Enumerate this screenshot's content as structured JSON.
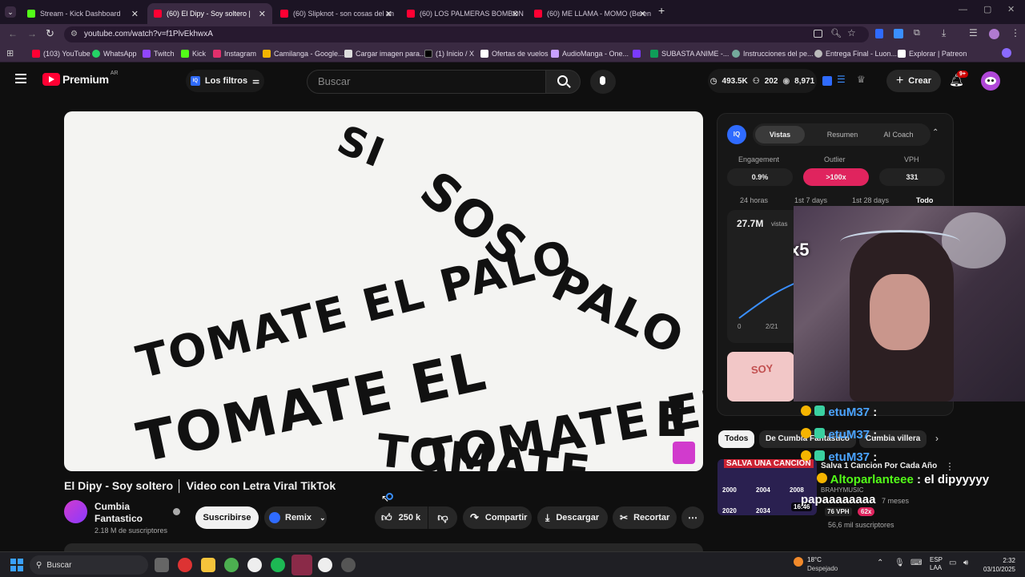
{
  "browser": {
    "tabs": [
      {
        "title": "Stream - Kick Dashboard",
        "color": "#53fc18"
      },
      {
        "title": "(60) El Dipy - Soy soltero |",
        "color": "#ff0033"
      },
      {
        "title": "(60) Slipknot - son cosas del an",
        "color": "#ff0033"
      },
      {
        "title": "(60) LOS PALMERAS BOMBON",
        "color": "#ff0033"
      },
      {
        "title": "(60) ME LLAMA - MOMO (Beren",
        "color": "#ff0033"
      }
    ],
    "new_tab": "+",
    "url": "youtube.com/watch?v=f1PlvEkhwxA",
    "bookmarks": [
      {
        "label": "(103) YouTube"
      },
      {
        "label": "WhatsApp"
      },
      {
        "label": "Twitch"
      },
      {
        "label": "Kick"
      },
      {
        "label": "Instagram"
      },
      {
        "label": "Camilanga - Google..."
      },
      {
        "label": "Cargar imagen para..."
      },
      {
        "label": "(1) Inicio / X"
      },
      {
        "label": "Ofertas de vuelos"
      },
      {
        "label": "AudioManga - One..."
      },
      {
        "label": "SUBASTA ANIME -..."
      },
      {
        "label": "Instrucciones del pe..."
      },
      {
        "label": "Entrega Final - Luon..."
      },
      {
        "label": "Explorar | Patreon"
      }
    ]
  },
  "youtube": {
    "logo_text": "Premium",
    "logo_region": "AR",
    "filters_label": "Los filtros",
    "search_placeholder": "Buscar",
    "stats": {
      "views": "493.5K",
      "subs": "202",
      "watch": "8,971"
    },
    "create_label": "Crear",
    "notif_badge": "9+"
  },
  "video": {
    "lyrics": [
      "SI",
      "SOS",
      "TOMATE EL PALO",
      "TOMATE EL",
      "TOMATE EL",
      "TOMATE",
      "PALO",
      "E"
    ],
    "title": "El Dipy - Soy soltero │ Video con Letra Viral TikTok",
    "channel_name_line1": "Cumbia",
    "channel_name_line2": "Fantastico",
    "subscribers": "2.18 M de suscriptores",
    "subscribe_label": "Suscribirse",
    "remix_label": "Remix",
    "likes": "250 k",
    "share_label": "Compartir",
    "download_label": "Descargar",
    "clip_label": "Recortar"
  },
  "vidiq": {
    "tabs": [
      "Vistas",
      "Resumen",
      "AI Coach"
    ],
    "metrics": [
      {
        "label": "Engagement",
        "value": "0.9%"
      },
      {
        "label": "Outlier",
        "value": ">100x"
      },
      {
        "label": "VPH",
        "value": "331"
      }
    ],
    "ranges": [
      "24 horas",
      "1st 7 days",
      "1st 28 days",
      "Todo"
    ],
    "views_total": "27.7M",
    "views_label": "vistas",
    "axis_labels": [
      "0",
      "2/21"
    ],
    "multiplier": "x5"
  },
  "chips": [
    "Todos",
    "De Cumbia Fantastico",
    "Cumbia villera"
  ],
  "recommendation": {
    "thumb_banner": "SALVA UNA CANCION",
    "years": [
      "2000",
      "2004",
      "2008",
      "2020",
      "2034",
      "16:46"
    ],
    "title": "Salva 1 Cancion Por Cada Año",
    "channel": "BRAHYMUSIC",
    "vph": "76 VPH",
    "outlier": "62x",
    "age": "7 meses",
    "subs": "56,6 mil suscriptores"
  },
  "chat": [
    {
      "user": "etuM37",
      "sep": ":",
      "msg": ""
    },
    {
      "user": "etuM37",
      "sep": ":",
      "msg": ""
    },
    {
      "user": "etuM37",
      "sep": ":",
      "msg": ""
    },
    {
      "user": "Altoparlanteee",
      "sep": ":",
      "msg": "el dipyyyyy"
    },
    {
      "user": "",
      "sep": "",
      "msg": "papaaaaaaaa"
    }
  ],
  "taskbar": {
    "search_label": "Buscar",
    "weather_temp": "18°C",
    "weather_desc": "Despejado",
    "lang": "ESP",
    "lang2": "LAA",
    "time": "2:32",
    "date": "03/10/2025"
  }
}
